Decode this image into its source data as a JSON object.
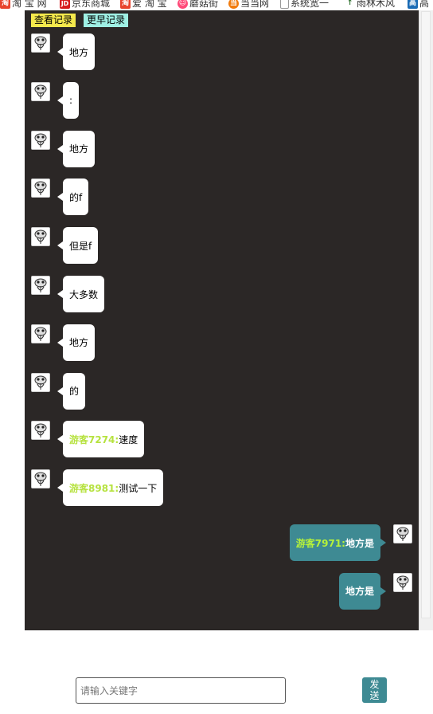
{
  "bookmarks": [
    {
      "label": "淘 宝 网",
      "icon": "taobao-icon",
      "color": "#e8432d",
      "glyph": "淘"
    },
    {
      "label": "京东商城",
      "icon": "jd-icon",
      "color": "#d71c1e",
      "glyph": "JD"
    },
    {
      "label": "爱 淘 宝",
      "icon": "aitaobao-icon",
      "color": "#e8432d",
      "glyph": "淘"
    },
    {
      "label": "蘑菇街",
      "icon": "mogujie-icon",
      "color": "#ff4b7a",
      "glyph": "☺"
    },
    {
      "label": "当当网",
      "icon": "dangdang-icon",
      "color": "#f17c0e",
      "glyph": "当"
    },
    {
      "label": "系统宽一",
      "icon": "page-icon",
      "color": "#ffffff",
      "glyph": ""
    },
    {
      "label": "雨林木风",
      "icon": "yulin-icon",
      "color": "#2a6e2a",
      "glyph": "↑"
    },
    {
      "label": "高",
      "icon": "gao-icon",
      "color": "#1a6bb5",
      "glyph": "高"
    }
  ],
  "toolbar": {
    "view_label": "查看记录",
    "more_label": "更早记录"
  },
  "messages": [
    {
      "side": "left",
      "name": "",
      "text": "地方"
    },
    {
      "side": "left",
      "name": "",
      "text": ":"
    },
    {
      "side": "left",
      "name": "",
      "text": "地方"
    },
    {
      "side": "left",
      "name": "",
      "text": "的f"
    },
    {
      "side": "left",
      "name": "",
      "text": "但是f"
    },
    {
      "side": "left",
      "name": "",
      "text": "大多数"
    },
    {
      "side": "left",
      "name": "",
      "text": "地方"
    },
    {
      "side": "left",
      "name": "",
      "text": "的"
    },
    {
      "side": "left",
      "name": "游客7274:",
      "text": "速度"
    },
    {
      "side": "left",
      "name": "游客8981:",
      "text": "测试一下"
    },
    {
      "side": "right",
      "name": "游客7971:",
      "text": "地方是"
    },
    {
      "side": "right",
      "name": "",
      "text": "地方是"
    }
  ],
  "composer": {
    "placeholder": "请输入关键字",
    "value": "",
    "send_label": "发送"
  },
  "colors": {
    "chat_bg": "#2b2726",
    "right_bubble": "#3e8a93",
    "name_green": "#b6e23f"
  }
}
